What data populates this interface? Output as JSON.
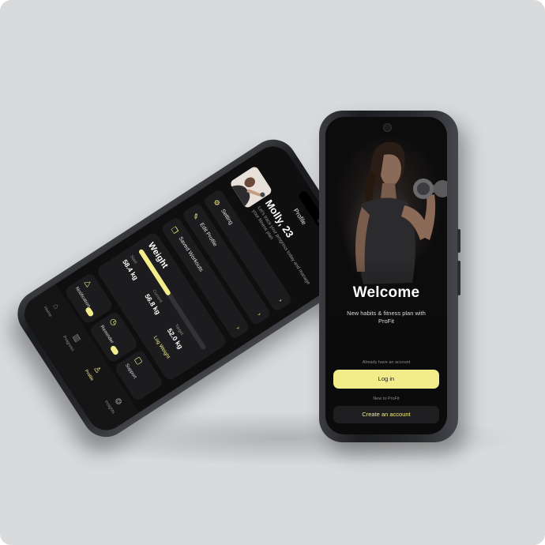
{
  "welcome_screen": {
    "title": "Welcome",
    "subtitle": "New habits & fitness plan with ProFit",
    "have_account": "Already have an account",
    "login_label": "Log in",
    "new_to": "New to ProFit",
    "create_label": "Create an account"
  },
  "profile_screen": {
    "header": "Profile",
    "name": "Molly, 23",
    "description": "Let's track your progress today and manage your fitness plan",
    "menu": [
      {
        "label": "Setting",
        "icon": "gear-icon"
      },
      {
        "label": "Edit Profile",
        "icon": "pencil-icon"
      },
      {
        "label": "Saved Workouts",
        "icon": "bookmark-icon"
      }
    ],
    "weight": {
      "title": "Weight",
      "progress": 0.45,
      "start_label": "Start",
      "start_value": "58.4 kg",
      "current_label": "Current",
      "current_value": "56.8 kg",
      "target_label": "Target",
      "target_value": "52.0 kg",
      "log_label": "Log Weight"
    },
    "tiles": [
      {
        "label": "Notification",
        "icon": "bell-icon",
        "toggle": true
      },
      {
        "label": "Reminder",
        "icon": "clock-icon",
        "toggle": true
      },
      {
        "label": "Support",
        "icon": "chat-icon",
        "toggle": false
      }
    ],
    "tabs": [
      {
        "label": "Home",
        "icon": "home-icon",
        "active": false
      },
      {
        "label": "Progress",
        "icon": "chart-icon",
        "active": false
      },
      {
        "label": "Profile",
        "icon": "user-icon",
        "active": true
      },
      {
        "label": "Insights",
        "icon": "brain-icon",
        "active": false
      }
    ]
  },
  "colors": {
    "accent": "#f2ec8a",
    "background": "#d8dadc",
    "screen": "#0f0f10"
  }
}
